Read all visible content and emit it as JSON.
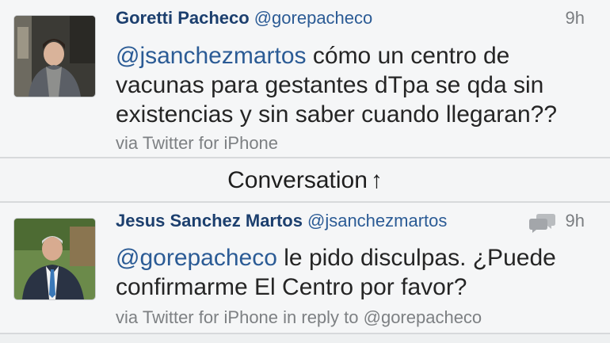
{
  "tweets": [
    {
      "name": "Goretti Pacheco",
      "handle": "@gorepacheco",
      "time": "9h",
      "mention": "@jsanchezmartos",
      "text_line1_rest": " cómo un centro de",
      "text_line2": "vacunas para gestantes dTpa se qda sin",
      "text_line3": "existencias y sin saber cuando llegaran??",
      "via": "via Twitter for iPhone"
    },
    {
      "name": "Jesus Sanchez Martos",
      "handle": "@jsanchezmartos",
      "time": "9h",
      "mention": "@gorepacheco",
      "text_line1_rest": " le pido disculpas. ¿Puede",
      "text_line2": "confirmarme El Centro por favor?",
      "via": "via Twitter for iPhone in reply to @gorepacheco"
    }
  ],
  "conversation": {
    "label": "Conversation",
    "arrow": "↑"
  },
  "icons": {
    "conversation": "speech-bubbles-icon"
  },
  "colors": {
    "name": "#1c3f6e",
    "link": "#2b5b95",
    "meta": "#7d8083"
  }
}
